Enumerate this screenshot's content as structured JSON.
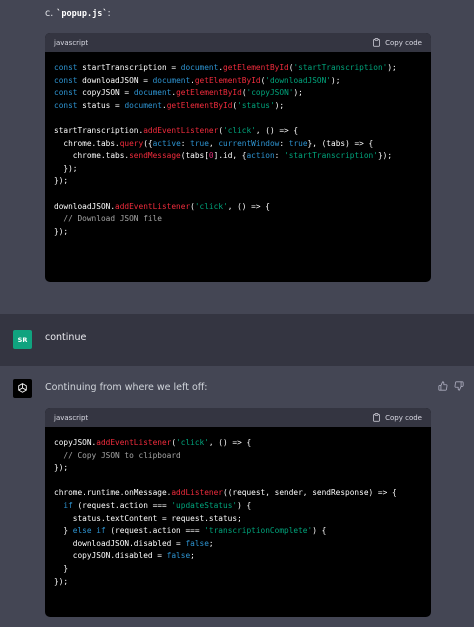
{
  "top": {
    "heading_prefix": "c. ",
    "heading_file": "`popup.js`",
    "heading_suffix": ":",
    "code": {
      "language": "javascript",
      "copy_label": "Copy code"
    }
  },
  "user_message": {
    "avatar": "SR",
    "text": "continue"
  },
  "assistant": {
    "text": "Continuing from where we left off:",
    "code": {
      "language": "javascript",
      "copy_label": "Copy code"
    }
  },
  "icons": {
    "copy": "clipboard-icon",
    "thumbs_up": "thumbs-up-icon",
    "thumbs_down": "thumbs-down-icon",
    "bot_avatar": "openai-logo-icon"
  },
  "colors": {
    "page_bg": "#444654",
    "user_bg": "#343541",
    "code_bg": "#000000",
    "keyword": "#2e95d3",
    "function": "#f22c3d",
    "string": "#00a67d",
    "number": "#df3079",
    "comment": "#a6a6a6",
    "user_avatar": "#10a37f"
  }
}
